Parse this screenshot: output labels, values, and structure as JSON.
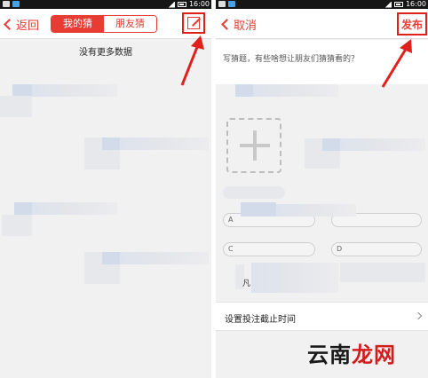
{
  "left_screen": {
    "status_time": "16:00",
    "nav": {
      "back_label": "返回",
      "tab_my_guess": "我的猜",
      "tab_friend_guess": "朋友猜"
    },
    "empty_message": "没有更多数据"
  },
  "right_screen": {
    "status_time": "16:00",
    "nav": {
      "cancel_label": "取消",
      "publish_label": "发布"
    },
    "question_placeholder": "写猜题，有些啥想让朋友们猜猜看的？",
    "options": [
      "A",
      "C",
      "D"
    ],
    "partial_text": "凡",
    "setting_label": "设置投注截止时间"
  },
  "watermark": {
    "part1": "云南",
    "part2": "龙网"
  },
  "colors": {
    "accent": "#e83b33",
    "annotation": "#e0201a"
  }
}
